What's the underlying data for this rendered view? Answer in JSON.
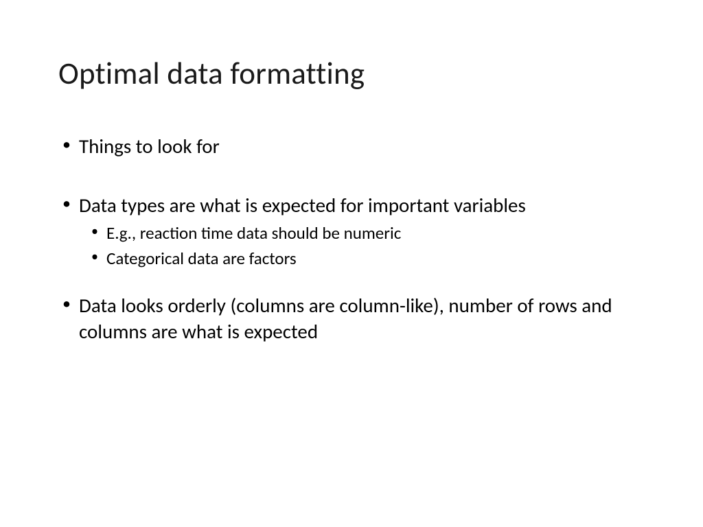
{
  "slide": {
    "title": "Optimal data formatting",
    "bullets": [
      {
        "level": 1,
        "text": "Things to look for"
      },
      {
        "level": 1,
        "text": "Data types are what is expected for important variables"
      },
      {
        "level": 2,
        "text": "E.g., reaction time data should be numeric"
      },
      {
        "level": 2,
        "text": "Categorical data are factors"
      },
      {
        "level": 1,
        "text": "Data looks orderly (columns are column-like), number of rows and columns are what is expected"
      }
    ]
  }
}
